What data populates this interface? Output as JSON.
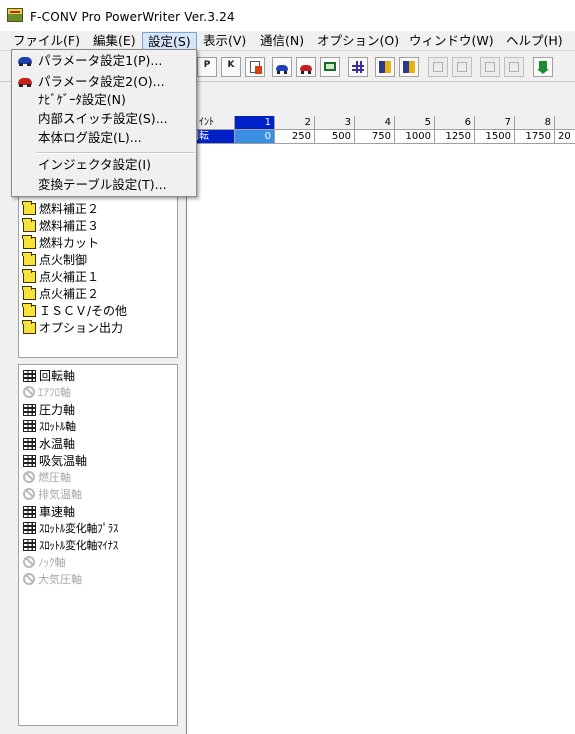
{
  "window": {
    "title": "F-CONV Pro PowerWriter Ver.3.24"
  },
  "menu": [
    {
      "label": "ファイル(F)"
    },
    {
      "label": "編集(E)"
    },
    {
      "label": "設定(S)"
    },
    {
      "label": "表示(V)"
    },
    {
      "label": "通信(N)"
    },
    {
      "label": "オプション(O)"
    },
    {
      "label": "ウィンドウ(W)"
    },
    {
      "label": "ヘルプ(H)"
    }
  ],
  "settings_menu": {
    "items": [
      {
        "label": "パラメータ設定1(P)...",
        "icon": "car-blue-icon"
      },
      {
        "label": "パラメータ設定2(O)...",
        "icon": "car-red-icon"
      },
      {
        "label": "ﾅﾋﾞｹﾞｰﾀ設定(N)"
      },
      {
        "label": "内部スイッチ設定(S)..."
      },
      {
        "label": "本体ログ設定(L)..."
      },
      {
        "label": "インジェクタ設定(I)"
      },
      {
        "label": "変換テーブル設定(T)..."
      }
    ]
  },
  "toolbar": {
    "glyphs": [
      "P",
      "K"
    ]
  },
  "map_list": {
    "items": [
      {
        "label": "燃料補正２"
      },
      {
        "label": "燃料補正３"
      },
      {
        "label": "燃料カット"
      },
      {
        "label": "点火制御"
      },
      {
        "label": "点火補正１"
      },
      {
        "label": "点火補正２"
      },
      {
        "label": "ＩＳＣＶ/その他"
      },
      {
        "label": "オプション出力"
      }
    ]
  },
  "axis_list": {
    "items": [
      {
        "label": "回転軸",
        "enabled": true
      },
      {
        "label": "ｴｱﾌﾛ軸",
        "enabled": false
      },
      {
        "label": "圧力軸",
        "enabled": true
      },
      {
        "label": "ｽﾛｯﾄﾙ軸",
        "enabled": true
      },
      {
        "label": "水温軸",
        "enabled": true
      },
      {
        "label": "吸気温軸",
        "enabled": true
      },
      {
        "label": "燃圧軸",
        "enabled": false
      },
      {
        "label": "排気温軸",
        "enabled": false
      },
      {
        "label": "車速軸",
        "enabled": true
      },
      {
        "label": "ｽﾛｯﾄﾙ変化軸ﾌﾟﾗｽ",
        "enabled": true
      },
      {
        "label": "ｽﾛｯﾄﾙ変化軸ﾏｲﾅｽ",
        "enabled": true
      },
      {
        "label": "ﾉｯｸ軸",
        "enabled": false
      },
      {
        "label": "大気圧軸",
        "enabled": false
      }
    ]
  },
  "axis_table": {
    "header_label": "ﾎﾟｲﾝﾄ",
    "row_label": "回転",
    "columns": [
      "1",
      "2",
      "3",
      "4",
      "5",
      "6",
      "7",
      "8"
    ],
    "values": [
      "0",
      "250",
      "500",
      "750",
      "1000",
      "1250",
      "1500",
      "1750",
      "20"
    ]
  }
}
